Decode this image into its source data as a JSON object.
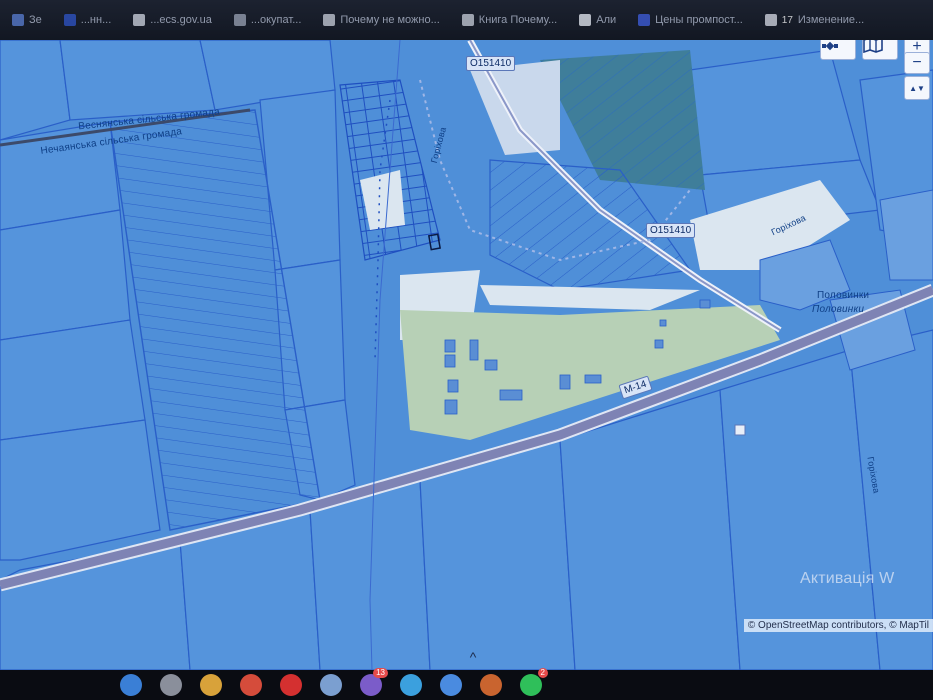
{
  "tabs": [
    {
      "label": "Зе",
      "icon": "app-icon",
      "color": "#5a7fd4"
    },
    {
      "label": "...нн...",
      "icon": "tab-icon",
      "color": "#2f55c9"
    },
    {
      "label": "...ecs.gov.ua",
      "icon": "w-icon",
      "color": "#d0d6e2"
    },
    {
      "label": "...окупат...",
      "icon": "gear-icon",
      "color": "#9aa3b5"
    },
    {
      "label": "Почему не можно...",
      "icon": "doc-icon",
      "color": "#c9cfdb"
    },
    {
      "label": "Книга Почему...",
      "icon": "doc-icon",
      "color": "#c9cfdb"
    },
    {
      "label": "Али",
      "icon": "drive-icon",
      "color": "#e8edf6"
    },
    {
      "label": "Цены промпост...",
      "icon": "app-icon",
      "color": "#3f5fe0"
    },
    {
      "label": "Изменение...",
      "icon": "count-icon",
      "color": "#d7dbe6",
      "badge": "17"
    }
  ],
  "map": {
    "labels": {
      "vesnianska": "Веснянська сільська громада",
      "nechaianska": "Нечаянська сільська громада",
      "road_badge_1": "O151410",
      "road_badge_2": "O151410",
      "highway": "M-14",
      "village_1": "Половинки",
      "village_2": "Половинки",
      "street_1": "Горіхова",
      "street_2": "Горіхова",
      "street_3": "Горіхова",
      "watermark": "Активація W"
    },
    "colors": {
      "water_base": "#4f8fd8",
      "parcel_fill": "#5a9ae0",
      "parcel_stroke": "#2a5fc8",
      "green_zone": "#a9c9b2",
      "light_zone": "#d6e3ee",
      "highway": "#7e83b4",
      "dark_field": "#3c7a9a"
    }
  },
  "controls": {
    "zoom_in": "+",
    "zoom_out": "−",
    "compass": "▲▼",
    "layers_icon": "map-icon",
    "tools_icon": "satellite-icon"
  },
  "attribution": "© OpenStreetMap contributors, © MapTil",
  "taskbar": {
    "chevron": "^",
    "apps": [
      {
        "name": "finder-icon",
        "color": "#3a7fd6"
      },
      {
        "name": "launchpad-icon",
        "color": "#8a8f9b"
      },
      {
        "name": "safari-icon",
        "color": "#d8a23a"
      },
      {
        "name": "chrome-icon",
        "color": "#d54c3b"
      },
      {
        "name": "opera-icon",
        "color": "#d43030"
      },
      {
        "name": "folder-icon",
        "color": "#7b9fd0"
      },
      {
        "name": "viber-icon",
        "color": "#7b5cc9",
        "badge": "13"
      },
      {
        "name": "telegram-icon",
        "color": "#3ba0de"
      },
      {
        "name": "chrome-2-icon",
        "color": "#4a8be0"
      },
      {
        "name": "rocket-icon",
        "color": "#c9642f"
      },
      {
        "name": "whatsapp-icon",
        "color": "#2fbf5a",
        "badge": "2"
      }
    ]
  }
}
